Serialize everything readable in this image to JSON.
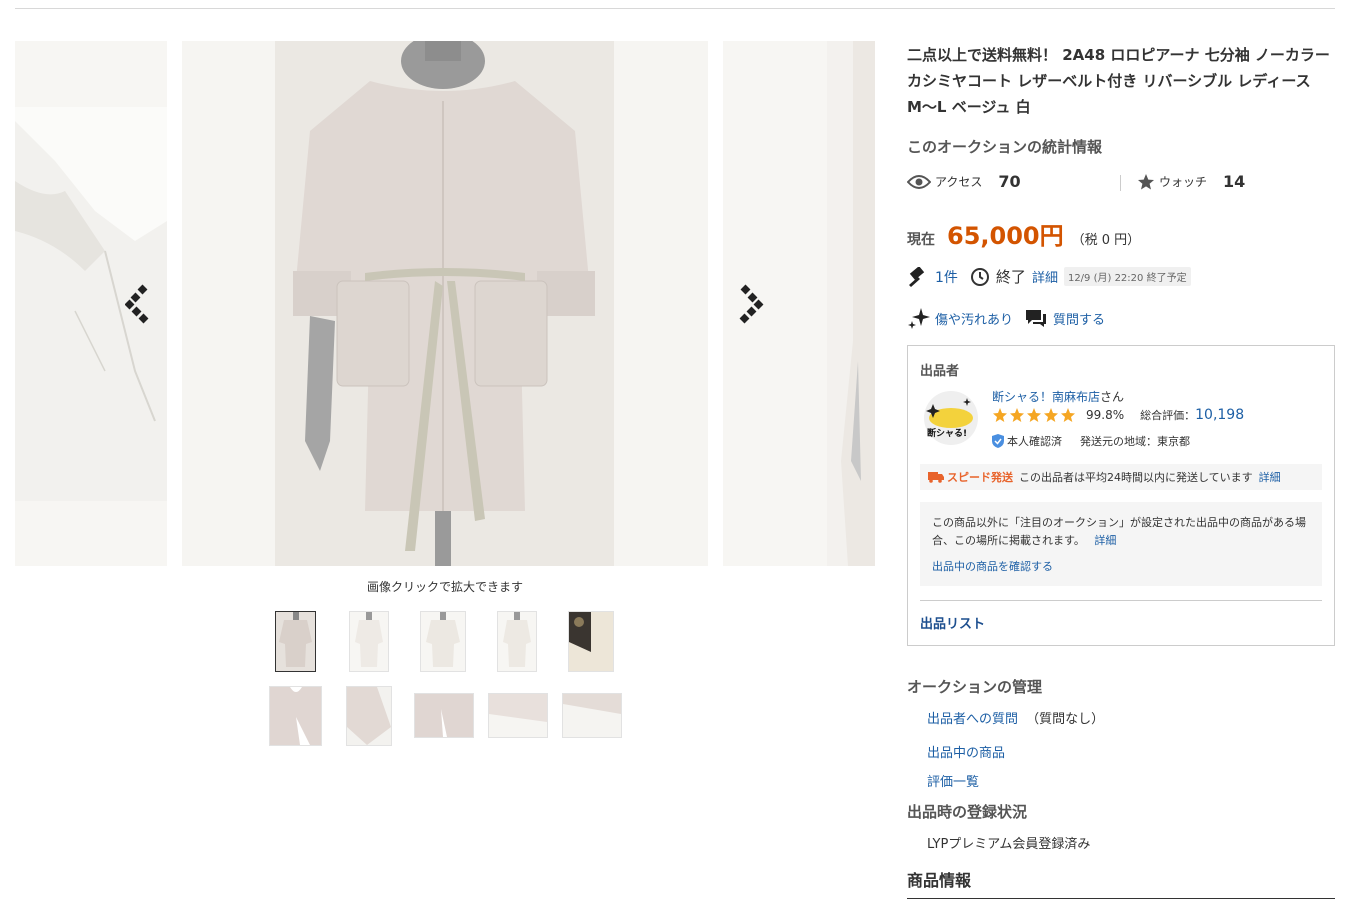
{
  "gallery": {
    "caption": "画像クリックで拡大できます",
    "thumbnail_count": 10
  },
  "item": {
    "title": "二点以上で送料無料！ 2A48 ロロピアーナ 七分袖 ノーカラー カシミヤコート レザーベルト付き リバーシブル レディース M〜L ベージュ 白"
  },
  "stats": {
    "heading": "このオークションの統計情報",
    "access_label": "アクセス",
    "access_value": "70",
    "watch_label": "ウォッチ",
    "watch_value": "14"
  },
  "price": {
    "label": "現在",
    "value": "65,000円",
    "tax": "（税 0 円）"
  },
  "bid": {
    "count": "1件",
    "end_label": "終了",
    "detail": "詳細",
    "end_time": "12/9 (月) 22:20 終了予定"
  },
  "condition": {
    "label": "傷や汚れあり",
    "question": "質問する"
  },
  "seller": {
    "heading": "出品者",
    "name": "断シャる！南麻布店",
    "suffix": "さん",
    "rating_pct": "99.8%",
    "total_label": "総合評価：",
    "total_value": "10,198",
    "verified": "本人確認済",
    "region": "発送元の地域：東京都",
    "logo_text": "断シャる!",
    "speed_label": "スピード発送",
    "speed_text": "この出品者は平均24時間以内に発送しています",
    "speed_detail": "詳細",
    "notice_text": "この商品以外に「注目のオークション」が設定された出品中の商品がある場合、この場所に掲載されます。",
    "notice_detail": "詳細",
    "notice_link": "出品中の商品を確認する",
    "list_link": "出品リスト"
  },
  "management": {
    "heading": "オークションの管理",
    "q_link": "出品者への質問",
    "q_note": "（質問なし）",
    "items_link": "出品中の商品",
    "ratings_link": "評価一覧"
  },
  "registration": {
    "heading": "出品時の登録状況",
    "value": "LYPプレミアム会員登録済み"
  },
  "product_info": {
    "heading": "商品情報"
  },
  "colors": {
    "price": "#d35400",
    "link": "#1d5fa5",
    "star": "#f5a623"
  }
}
